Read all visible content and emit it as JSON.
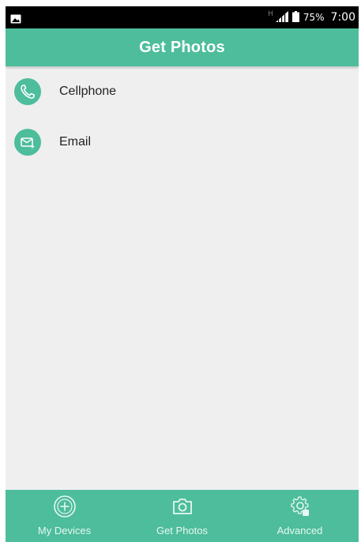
{
  "status_bar": {
    "network_type": "H",
    "battery_percent": "75%",
    "time": "7:00",
    "icons": [
      "image-notification-icon",
      "signal-icon",
      "battery-icon"
    ]
  },
  "app_bar": {
    "title": "Get Photos"
  },
  "list": {
    "items": [
      {
        "label": "Cellphone",
        "icon": "phone-icon"
      },
      {
        "label": "Email",
        "icon": "email-icon"
      }
    ]
  },
  "bottom_nav": {
    "items": [
      {
        "label": "My Devices",
        "icon": "plus-circle-icon"
      },
      {
        "label": "Get Photos",
        "icon": "camera-icon"
      },
      {
        "label": "Advanced",
        "icon": "gear-icon"
      }
    ]
  },
  "colors": {
    "accent": "#4dbd9b",
    "background": "#efefef",
    "status_bar": "#000000"
  }
}
